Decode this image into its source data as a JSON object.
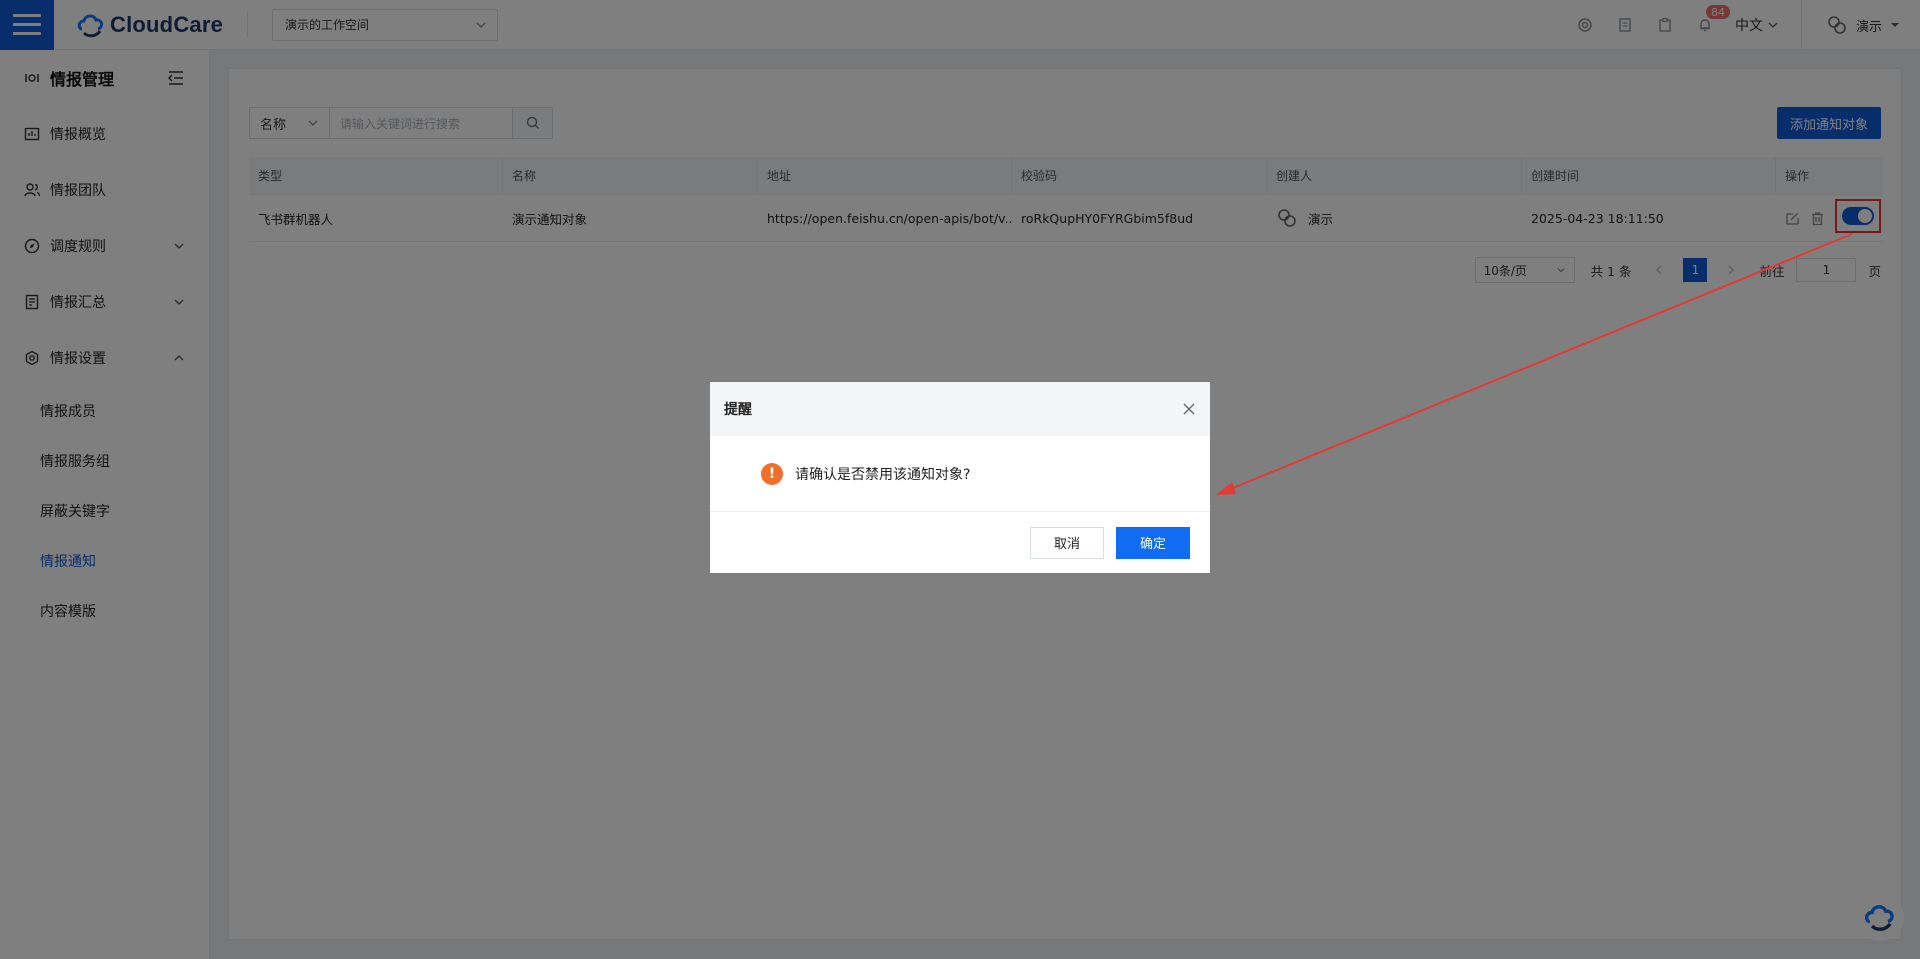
{
  "header": {
    "brand": "CloudCare",
    "workspace": "演示的工作空间",
    "notification_count": "84",
    "language": "中文",
    "user": "演示"
  },
  "sidebar": {
    "title": "情报管理",
    "items": [
      {
        "label": "情报概览",
        "icon": "overview-icon"
      },
      {
        "label": "情报团队",
        "icon": "team-icon"
      },
      {
        "label": "调度规则",
        "icon": "compass-icon"
      },
      {
        "label": "情报汇总",
        "icon": "document-icon"
      },
      {
        "label": "情报设置",
        "icon": "settings-icon"
      }
    ],
    "subitems": [
      "情报成员",
      "情报服务组",
      "屏蔽关键字",
      "情报通知",
      "内容模版"
    ],
    "active": "情报通知"
  },
  "toolbar": {
    "filter_field": "名称",
    "search_placeholder": "请输入关键词进行搜索",
    "add_button": "添加通知对象"
  },
  "table": {
    "columns": [
      "类型",
      "名称",
      "地址",
      "校验码",
      "创建人",
      "创建时间",
      "操作"
    ],
    "rows": [
      {
        "type": "飞书群机器人",
        "name": "演示通知对象",
        "address": "https://open.feishu.cn/open-apis/bot/v...",
        "code": "roRkQupHY0FYRGbim5f8ud",
        "creator": "演示",
        "created": "2025-04-23 18:11:50",
        "enabled": true
      }
    ]
  },
  "pagination": {
    "page_size": "10条/页",
    "total": "共 1 条",
    "current": "1",
    "goto_label": "前往",
    "goto_value": "1",
    "page_suffix": "页"
  },
  "dialog": {
    "title": "提醒",
    "message": "请确认是否禁用该通知对象?",
    "cancel": "取消",
    "confirm": "确定"
  },
  "colors": {
    "primary": "#0f5bd6",
    "warning": "#f0702b",
    "highlight": "#e53935"
  }
}
